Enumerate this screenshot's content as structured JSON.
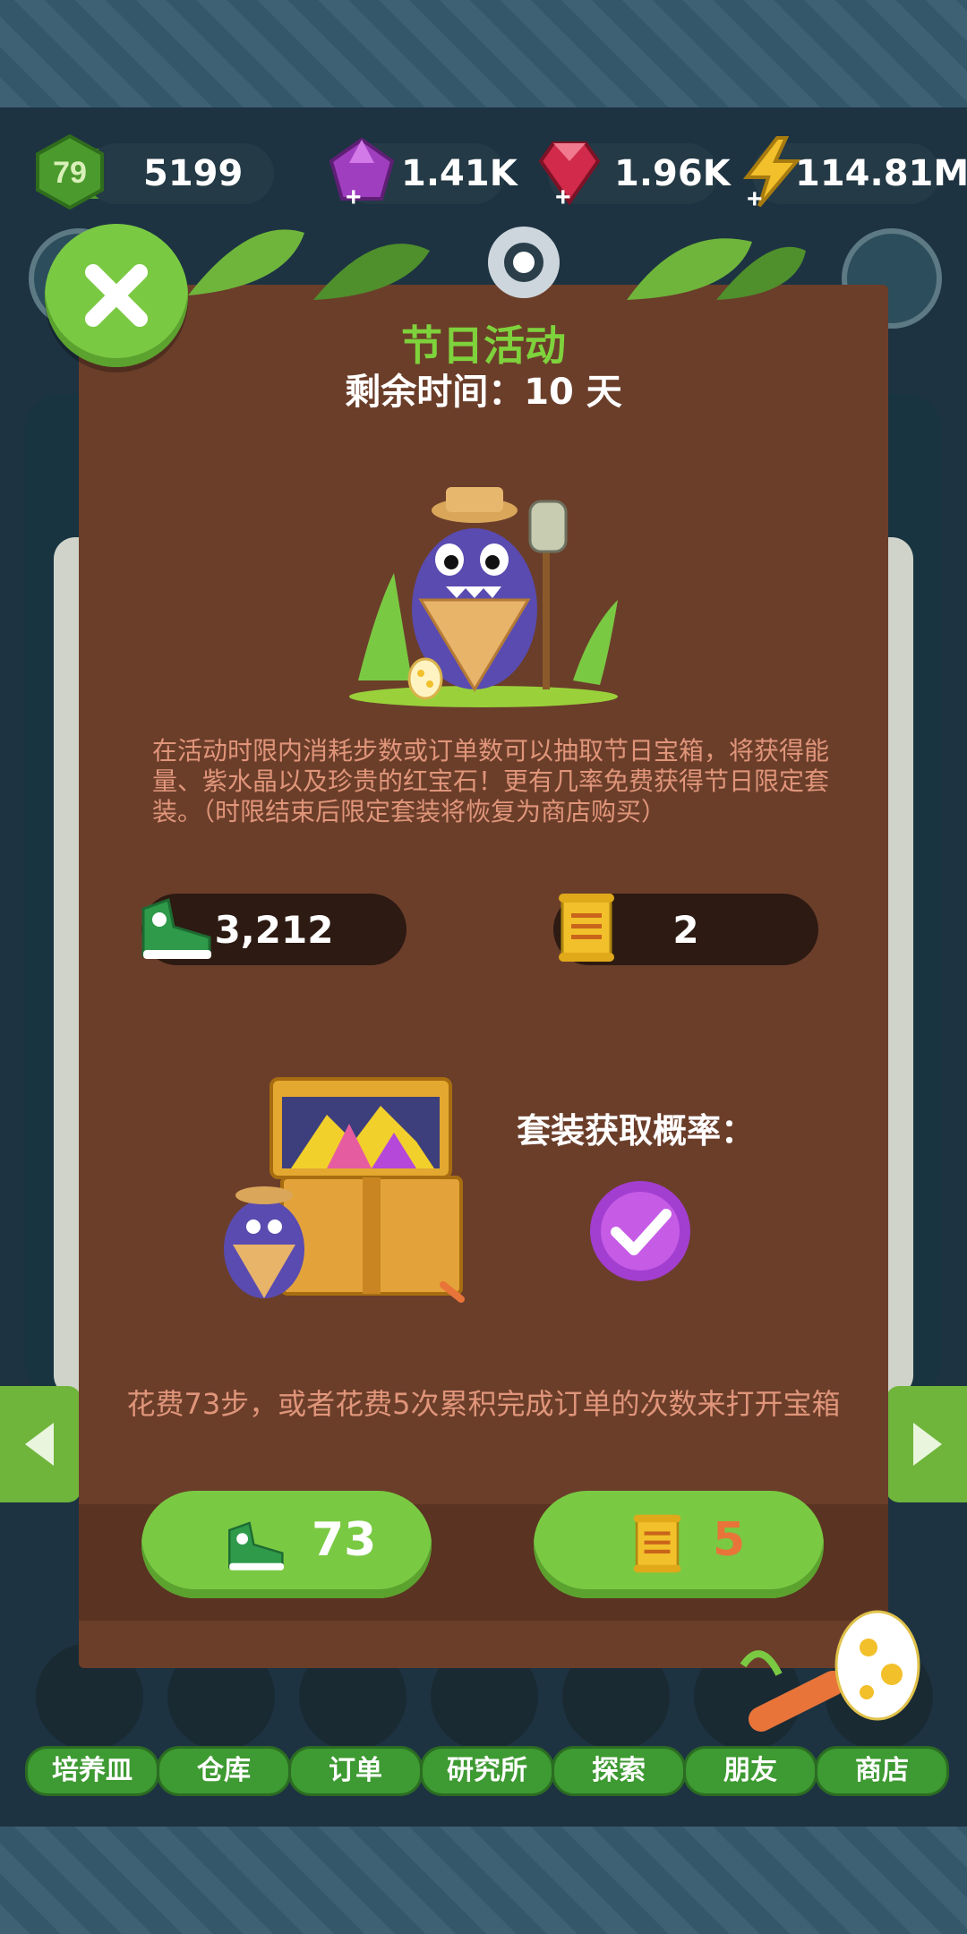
{
  "top_bar": {
    "level": "79",
    "steps": "5199",
    "crystals": "1.41K",
    "rubies": "1.96K",
    "energy": "114.81M"
  },
  "modal": {
    "title": "节日活动",
    "subtitle": "剩余时间：10 天",
    "description": "在活动时限内消耗步数或订单数可以抽取节日宝箱，将获得能量、紫水晶以及珍贵的红宝石！更有几率免费获得节日限定套装。（时限结束后限定套装将恢复为商店购买）",
    "steps_count": "3,212",
    "orders_count": "2",
    "odds_label": "套装获取概率：",
    "cost_text": "花费73步，或者花费5次累积完成订单的次数来打开宝箱",
    "step_cost": "73",
    "order_cost": "5"
  },
  "nav": {
    "items": [
      {
        "label": "培养皿"
      },
      {
        "label": "仓库"
      },
      {
        "label": "订单"
      },
      {
        "label": "研究所"
      },
      {
        "label": "探索"
      },
      {
        "label": "朋友"
      },
      {
        "label": "商店"
      }
    ]
  },
  "colors": {
    "accent_green": "#7ac943",
    "title_green": "#7ed23c",
    "modal_brown": "#6b3e2a",
    "desc_salmon": "#e0957a",
    "order_cost_color": "#e8743a"
  }
}
